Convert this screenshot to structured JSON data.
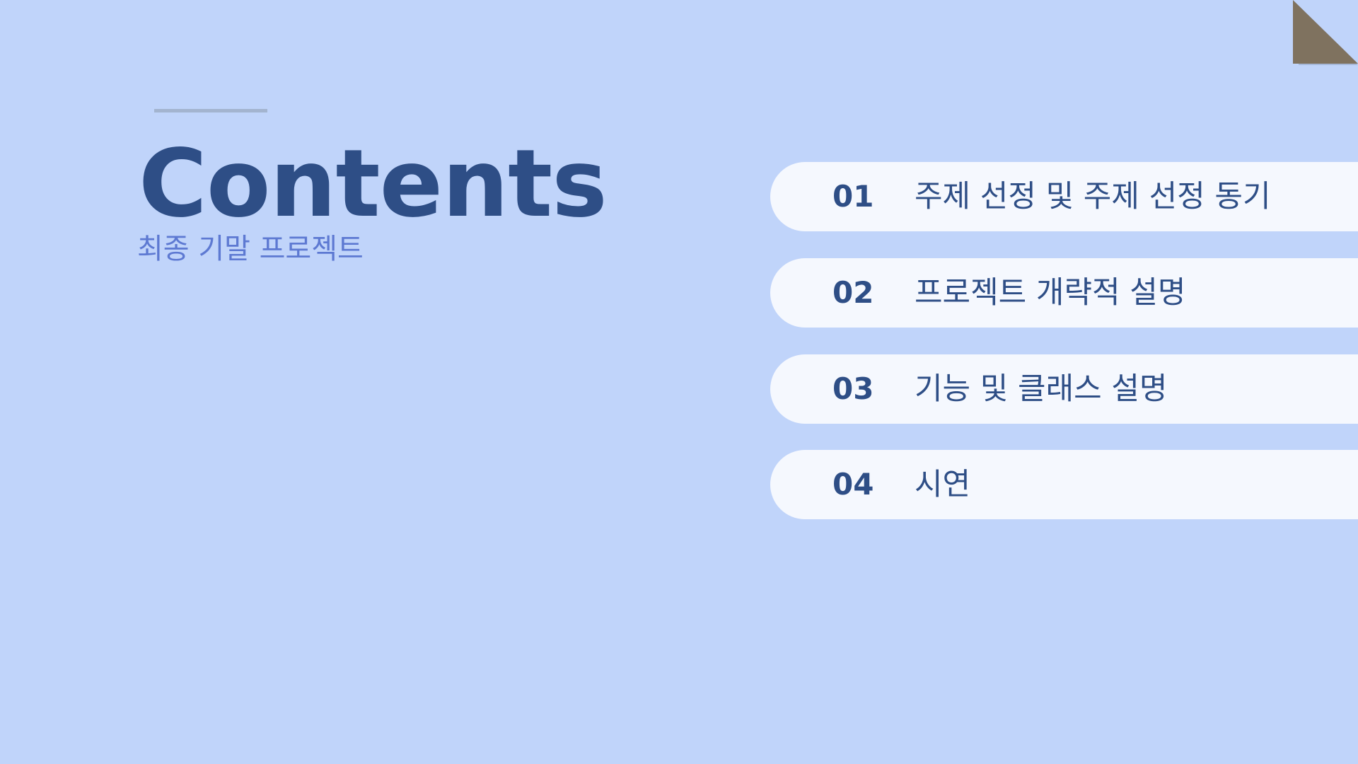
{
  "title": "Contents",
  "subtitle": "최종 기말 프로젝트",
  "toc": [
    {
      "number": "01",
      "label": "주제 선정 및 주제 선정 동기"
    },
    {
      "number": "02",
      "label": "프로젝트 개략적 설명"
    },
    {
      "number": "03",
      "label": "기능 및 클래스 설명"
    },
    {
      "number": "04",
      "label": "시연"
    }
  ],
  "colors": {
    "background": "#c0d4fa",
    "title": "#2e4e86",
    "subtitle": "#5d79d2",
    "item_background": "#f5f8fe",
    "accent_line": "#a3b4cf",
    "corner_fold": "#7f725f"
  }
}
